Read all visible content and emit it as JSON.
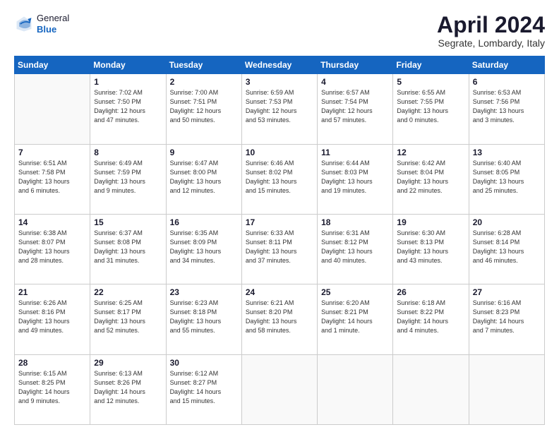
{
  "header": {
    "logo_line1": "General",
    "logo_line2": "Blue",
    "month": "April 2024",
    "location": "Segrate, Lombardy, Italy"
  },
  "weekdays": [
    "Sunday",
    "Monday",
    "Tuesday",
    "Wednesday",
    "Thursday",
    "Friday",
    "Saturday"
  ],
  "weeks": [
    [
      {
        "day": "",
        "info": ""
      },
      {
        "day": "1",
        "info": "Sunrise: 7:02 AM\nSunset: 7:50 PM\nDaylight: 12 hours\nand 47 minutes."
      },
      {
        "day": "2",
        "info": "Sunrise: 7:00 AM\nSunset: 7:51 PM\nDaylight: 12 hours\nand 50 minutes."
      },
      {
        "day": "3",
        "info": "Sunrise: 6:59 AM\nSunset: 7:53 PM\nDaylight: 12 hours\nand 53 minutes."
      },
      {
        "day": "4",
        "info": "Sunrise: 6:57 AM\nSunset: 7:54 PM\nDaylight: 12 hours\nand 57 minutes."
      },
      {
        "day": "5",
        "info": "Sunrise: 6:55 AM\nSunset: 7:55 PM\nDaylight: 13 hours\nand 0 minutes."
      },
      {
        "day": "6",
        "info": "Sunrise: 6:53 AM\nSunset: 7:56 PM\nDaylight: 13 hours\nand 3 minutes."
      }
    ],
    [
      {
        "day": "7",
        "info": "Sunrise: 6:51 AM\nSunset: 7:58 PM\nDaylight: 13 hours\nand 6 minutes."
      },
      {
        "day": "8",
        "info": "Sunrise: 6:49 AM\nSunset: 7:59 PM\nDaylight: 13 hours\nand 9 minutes."
      },
      {
        "day": "9",
        "info": "Sunrise: 6:47 AM\nSunset: 8:00 PM\nDaylight: 13 hours\nand 12 minutes."
      },
      {
        "day": "10",
        "info": "Sunrise: 6:46 AM\nSunset: 8:02 PM\nDaylight: 13 hours\nand 15 minutes."
      },
      {
        "day": "11",
        "info": "Sunrise: 6:44 AM\nSunset: 8:03 PM\nDaylight: 13 hours\nand 19 minutes."
      },
      {
        "day": "12",
        "info": "Sunrise: 6:42 AM\nSunset: 8:04 PM\nDaylight: 13 hours\nand 22 minutes."
      },
      {
        "day": "13",
        "info": "Sunrise: 6:40 AM\nSunset: 8:05 PM\nDaylight: 13 hours\nand 25 minutes."
      }
    ],
    [
      {
        "day": "14",
        "info": "Sunrise: 6:38 AM\nSunset: 8:07 PM\nDaylight: 13 hours\nand 28 minutes."
      },
      {
        "day": "15",
        "info": "Sunrise: 6:37 AM\nSunset: 8:08 PM\nDaylight: 13 hours\nand 31 minutes."
      },
      {
        "day": "16",
        "info": "Sunrise: 6:35 AM\nSunset: 8:09 PM\nDaylight: 13 hours\nand 34 minutes."
      },
      {
        "day": "17",
        "info": "Sunrise: 6:33 AM\nSunset: 8:11 PM\nDaylight: 13 hours\nand 37 minutes."
      },
      {
        "day": "18",
        "info": "Sunrise: 6:31 AM\nSunset: 8:12 PM\nDaylight: 13 hours\nand 40 minutes."
      },
      {
        "day": "19",
        "info": "Sunrise: 6:30 AM\nSunset: 8:13 PM\nDaylight: 13 hours\nand 43 minutes."
      },
      {
        "day": "20",
        "info": "Sunrise: 6:28 AM\nSunset: 8:14 PM\nDaylight: 13 hours\nand 46 minutes."
      }
    ],
    [
      {
        "day": "21",
        "info": "Sunrise: 6:26 AM\nSunset: 8:16 PM\nDaylight: 13 hours\nand 49 minutes."
      },
      {
        "day": "22",
        "info": "Sunrise: 6:25 AM\nSunset: 8:17 PM\nDaylight: 13 hours\nand 52 minutes."
      },
      {
        "day": "23",
        "info": "Sunrise: 6:23 AM\nSunset: 8:18 PM\nDaylight: 13 hours\nand 55 minutes."
      },
      {
        "day": "24",
        "info": "Sunrise: 6:21 AM\nSunset: 8:20 PM\nDaylight: 13 hours\nand 58 minutes."
      },
      {
        "day": "25",
        "info": "Sunrise: 6:20 AM\nSunset: 8:21 PM\nDaylight: 14 hours\nand 1 minute."
      },
      {
        "day": "26",
        "info": "Sunrise: 6:18 AM\nSunset: 8:22 PM\nDaylight: 14 hours\nand 4 minutes."
      },
      {
        "day": "27",
        "info": "Sunrise: 6:16 AM\nSunset: 8:23 PM\nDaylight: 14 hours\nand 7 minutes."
      }
    ],
    [
      {
        "day": "28",
        "info": "Sunrise: 6:15 AM\nSunset: 8:25 PM\nDaylight: 14 hours\nand 9 minutes."
      },
      {
        "day": "29",
        "info": "Sunrise: 6:13 AM\nSunset: 8:26 PM\nDaylight: 14 hours\nand 12 minutes."
      },
      {
        "day": "30",
        "info": "Sunrise: 6:12 AM\nSunset: 8:27 PM\nDaylight: 14 hours\nand 15 minutes."
      },
      {
        "day": "",
        "info": ""
      },
      {
        "day": "",
        "info": ""
      },
      {
        "day": "",
        "info": ""
      },
      {
        "day": "",
        "info": ""
      }
    ]
  ]
}
